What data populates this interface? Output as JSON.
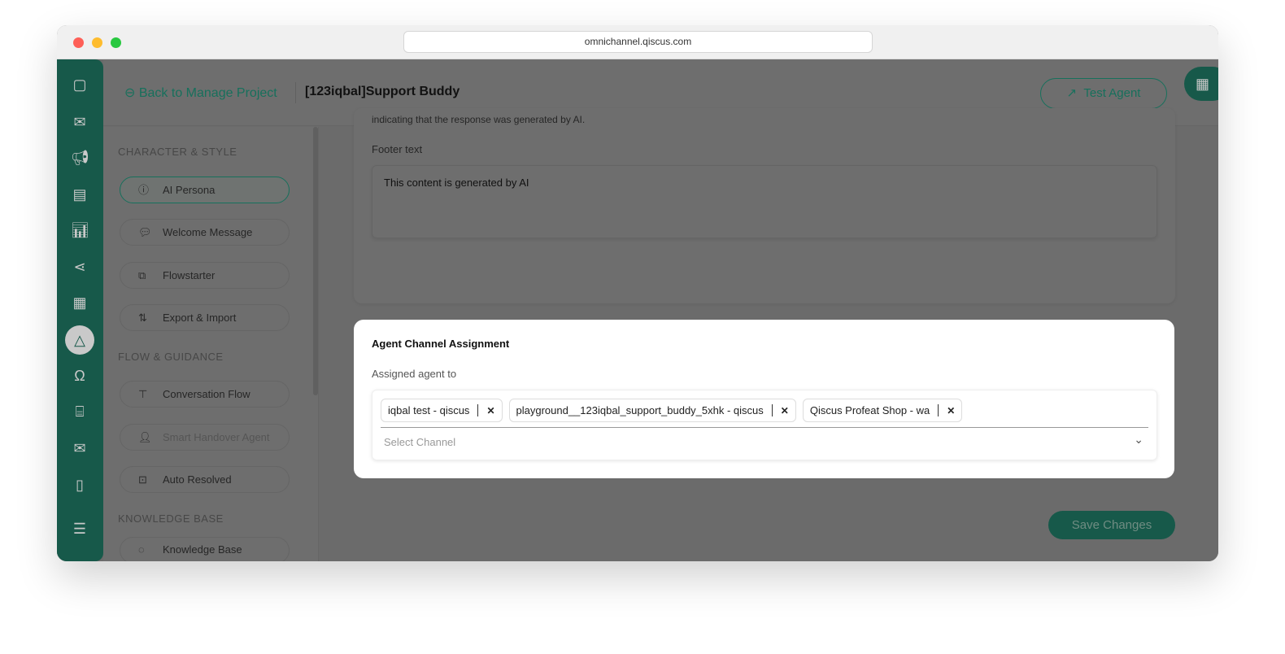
{
  "browser": {
    "url": "omnichannel.qiscus.com"
  },
  "header": {
    "back_label": "Back to Manage Project",
    "title": "[123iqbal]Support Buddy",
    "test_agent": "Test Agent"
  },
  "nav": {
    "sections": [
      {
        "title": "CHARACTER & STYLE",
        "items": [
          {
            "label": "AI Persona",
            "icon": "info-icon"
          },
          {
            "label": "Welcome Message",
            "icon": "chat-icon"
          },
          {
            "label": "Flowstarter",
            "icon": "flow-icon"
          },
          {
            "label": "Export & Import",
            "icon": "arrows-icon"
          }
        ]
      },
      {
        "title": "FLOW & GUIDANCE",
        "items": [
          {
            "label": "Conversation Flow",
            "icon": "hierarchy-icon"
          },
          {
            "label": "Smart Handover Agent",
            "icon": "user-check-icon"
          },
          {
            "label": "Auto Resolved",
            "icon": "chat-check-icon"
          }
        ]
      },
      {
        "title": "KNOWLEDGE BASE",
        "items": [
          {
            "label": "Knowledge Base",
            "icon": "bulb-icon"
          }
        ]
      }
    ]
  },
  "main": {
    "description": "indicating that the response was generated by AI.",
    "footer_label": "Footer text",
    "footer_value": "This content is generated by AI",
    "save": "Save Changes"
  },
  "modal": {
    "title": "Agent Channel Assignment",
    "label": "Assigned agent to",
    "chips": [
      "iqbal test - qiscus",
      "playground__123iqbal_support_buddy_5xhk - qiscus",
      "Qiscus Profeat Shop - wa"
    ],
    "placeholder": "Select Channel"
  },
  "colors": {
    "brand": "#36b197"
  }
}
